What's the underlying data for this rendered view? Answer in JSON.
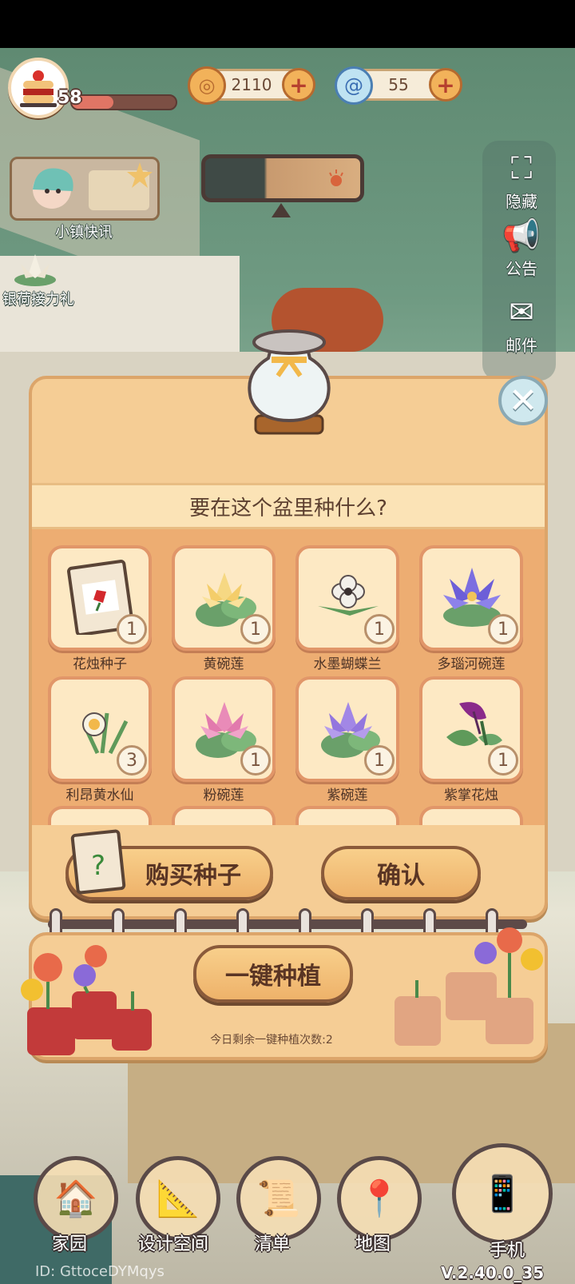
{
  "hud": {
    "level": "58",
    "level_progress": 0.4,
    "coins": "2110",
    "gems": "55"
  },
  "sidebar": {
    "hide_label": "隐藏",
    "notice_label": "公告",
    "mail_label": "邮件"
  },
  "events": {
    "news_label": "小镇快讯",
    "relay_label": "银荷接力礼"
  },
  "modal": {
    "question": "要在这个盆里种什么?",
    "items": [
      {
        "name": "花烛种子",
        "count": "1"
      },
      {
        "name": "黄碗莲",
        "count": "1"
      },
      {
        "name": "水墨蝴蝶兰",
        "count": "1"
      },
      {
        "name": "多瑙河碗莲",
        "count": "1"
      },
      {
        "name": "利昂黄水仙",
        "count": "3"
      },
      {
        "name": "粉碗莲",
        "count": "1"
      },
      {
        "name": "紫碗莲",
        "count": "1"
      },
      {
        "name": "紫掌花烛",
        "count": "1"
      }
    ],
    "buy_label": "购买种子",
    "confirm_label": "确认"
  },
  "planting": {
    "one_click_label": "一键种植",
    "remaining_text": "今日剩余一键种植次数:2"
  },
  "bottom_nav": {
    "home": "家园",
    "design": "设计空间",
    "list": "清单",
    "map": "地图",
    "phone": "手机"
  },
  "footer": {
    "user_id": "ID: GttoceDYMqys",
    "version": "V.2.40.0_35"
  },
  "colors": {
    "panel": "#f5cd95",
    "card": "#fde9c4",
    "accent_red": "#b6402f",
    "text_brown": "#5a3524"
  }
}
